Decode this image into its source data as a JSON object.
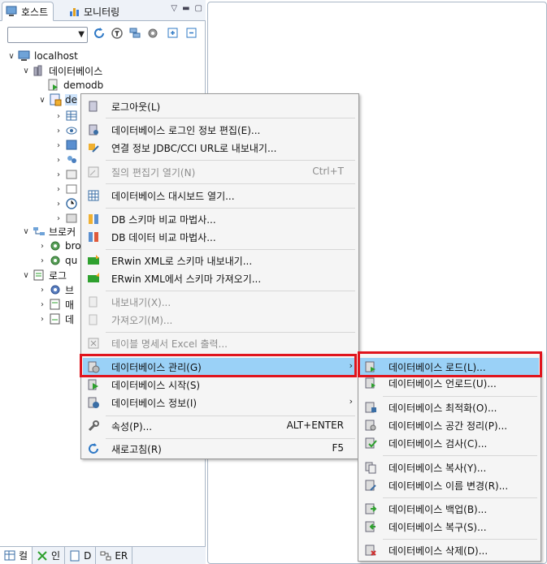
{
  "tabs": {
    "host": "호스트",
    "monitoring": "모니터링"
  },
  "bottom_tabs": [
    "컬",
    "인",
    "D",
    "ER"
  ],
  "tree": {
    "localhost": "localhost",
    "databases": "데이터베이스",
    "demodb": "demodb",
    "selected_db_partial": "de",
    "broker_partial": "브로커",
    "broker_child_1": "bro",
    "broker_child_2": "qu",
    "log_partial": "로그",
    "log_child_1": "브",
    "log_child_2": "매",
    "log_child_3": "데"
  },
  "context_menu": {
    "logout": "로그아웃(L)",
    "edit_login": "데이터베이스 로그인 정보 편집(E)...",
    "export_url": "연결 정보 JDBC/CCI URL로 내보내기...",
    "open_query_editor": "질의 편집기 열기(N)",
    "open_query_editor_accel": "Ctrl+T",
    "open_dashboard": "데이터베이스 대시보드 열기...",
    "schema_compare": "DB 스키마 비교 마법사...",
    "data_compare": "DB 데이터 비교 마법사...",
    "erwin_export": "ERwin XML로 스키마 내보내기...",
    "erwin_import": "ERwin XML에서 스키마 가져오기...",
    "export": "내보내기(X)...",
    "import": "가져오기(M)...",
    "table_spec_excel": "테이블 명세서 Excel 출력...",
    "db_manage": "데이터베이스 관리(G)",
    "db_start": "데이터베이스 시작(S)",
    "db_info": "데이터베이스 정보(I)",
    "properties": "속성(P)...",
    "properties_accel": "ALT+ENTER",
    "refresh": "새로고침(R)",
    "refresh_accel": "F5"
  },
  "submenu": {
    "load": "데이터베이스 로드(L)...",
    "unload": "데이터베이스 언로드(U)...",
    "optimize": "데이터베이스 최적화(O)...",
    "compact": "데이터베이스 공간 정리(P)...",
    "check": "데이터베이스 검사(C)...",
    "copy": "데이터베이스 복사(Y)...",
    "rename": "데이터베이스 이름 변경(R)...",
    "backup": "데이터베이스 백업(B)...",
    "restore": "데이터베이스 복구(S)...",
    "delete": "데이터베이스 삭제(D)..."
  },
  "colors": {
    "highlight_red": "#e0141d",
    "menu_highlight": "#9ad1f7",
    "tree_selection": "#cde3fb"
  }
}
